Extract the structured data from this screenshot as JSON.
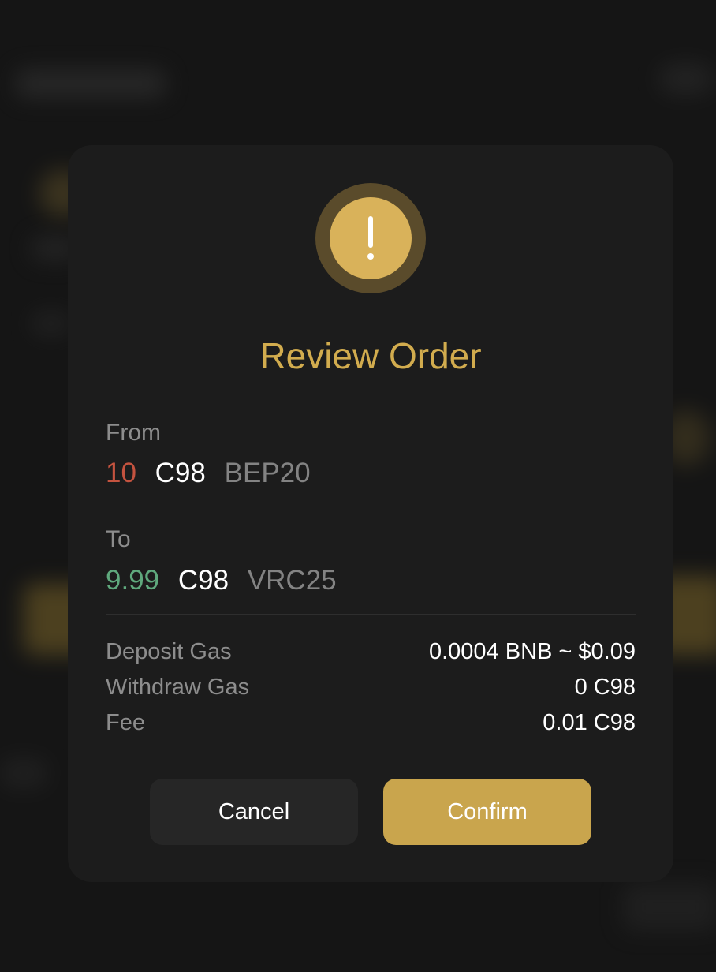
{
  "modal": {
    "title": "Review Order",
    "icon": "exclamation-alert-icon",
    "from": {
      "label": "From",
      "amount": "10",
      "token": "C98",
      "network": "BEP20"
    },
    "to": {
      "label": "To",
      "amount": "9.99",
      "token": "C98",
      "network": "VRC25"
    },
    "details": [
      {
        "label": "Deposit Gas",
        "value": "0.0004 BNB ~ $0.09"
      },
      {
        "label": "Withdraw Gas",
        "value": "0 C98"
      },
      {
        "label": "Fee",
        "value": "0.01 C98"
      }
    ],
    "buttons": {
      "cancel": "Cancel",
      "confirm": "Confirm"
    }
  },
  "colors": {
    "accent": "#d2ac4e",
    "confirm_button": "#c9a54d",
    "from_amount": "#c4533f",
    "to_amount": "#5fa97d",
    "modal_bg": "#1c1c1c"
  }
}
